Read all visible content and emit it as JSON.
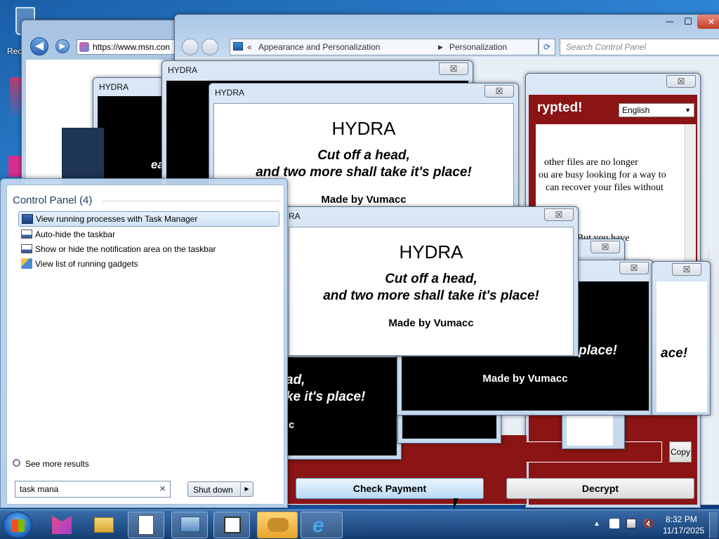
{
  "desktop": {
    "recycle_label": "Rec"
  },
  "ie": {
    "url": "https://www.msn.con"
  },
  "control_panel": {
    "path": [
      "«",
      "Appearance and Personalization",
      "Personalization"
    ],
    "search_placeholder": "Search Control Panel"
  },
  "hydra": {
    "title": "HYDRA",
    "heading": "HYDRA",
    "line1": "Cut off a head,",
    "line2": "and two more shall take it's place!",
    "credit": "Made by Vumacc",
    "close": "☒",
    "frag_ea": "ea",
    "frag_ad": "ad,",
    "frag_ke": "ke it's place!",
    "frag_c": "c",
    "frag_place": "place!",
    "frag_ace": "ace!",
    "frag_made": "Made by Vumacc",
    "frag_ra": "RA"
  },
  "ransom": {
    "header": "rypted!",
    "language": "English",
    "text_lines": [
      "other files are no longer",
      "ou are busy looking for a way to",
      "can recover your files without",
      "easily. But you have"
    ],
    "copy_label": "Copy",
    "check_payment_label": "Check Payment",
    "decrypt_label": "Decrypt",
    "close": "☒"
  },
  "start_menu": {
    "section_title": "Control Panel (4)",
    "items": [
      {
        "label": "View running processes with Task Manager",
        "icon": "task-manager-icon"
      },
      {
        "label": "Auto-hide the taskbar",
        "icon": "taskbar-icon"
      },
      {
        "label": "Show or hide the notification area on the taskbar",
        "icon": "notification-area-icon"
      },
      {
        "label": "View list of running gadgets",
        "icon": "gadgets-icon"
      }
    ],
    "see_more": "See more results",
    "search_value": "task mana",
    "shutdown_label": "Shut down",
    "clear": "×"
  },
  "taskbar": {
    "time": "8:32 PM",
    "date": "11/17/2025"
  },
  "window_controls": {
    "minimize": "—",
    "maximize": "☐",
    "close": "✕"
  }
}
